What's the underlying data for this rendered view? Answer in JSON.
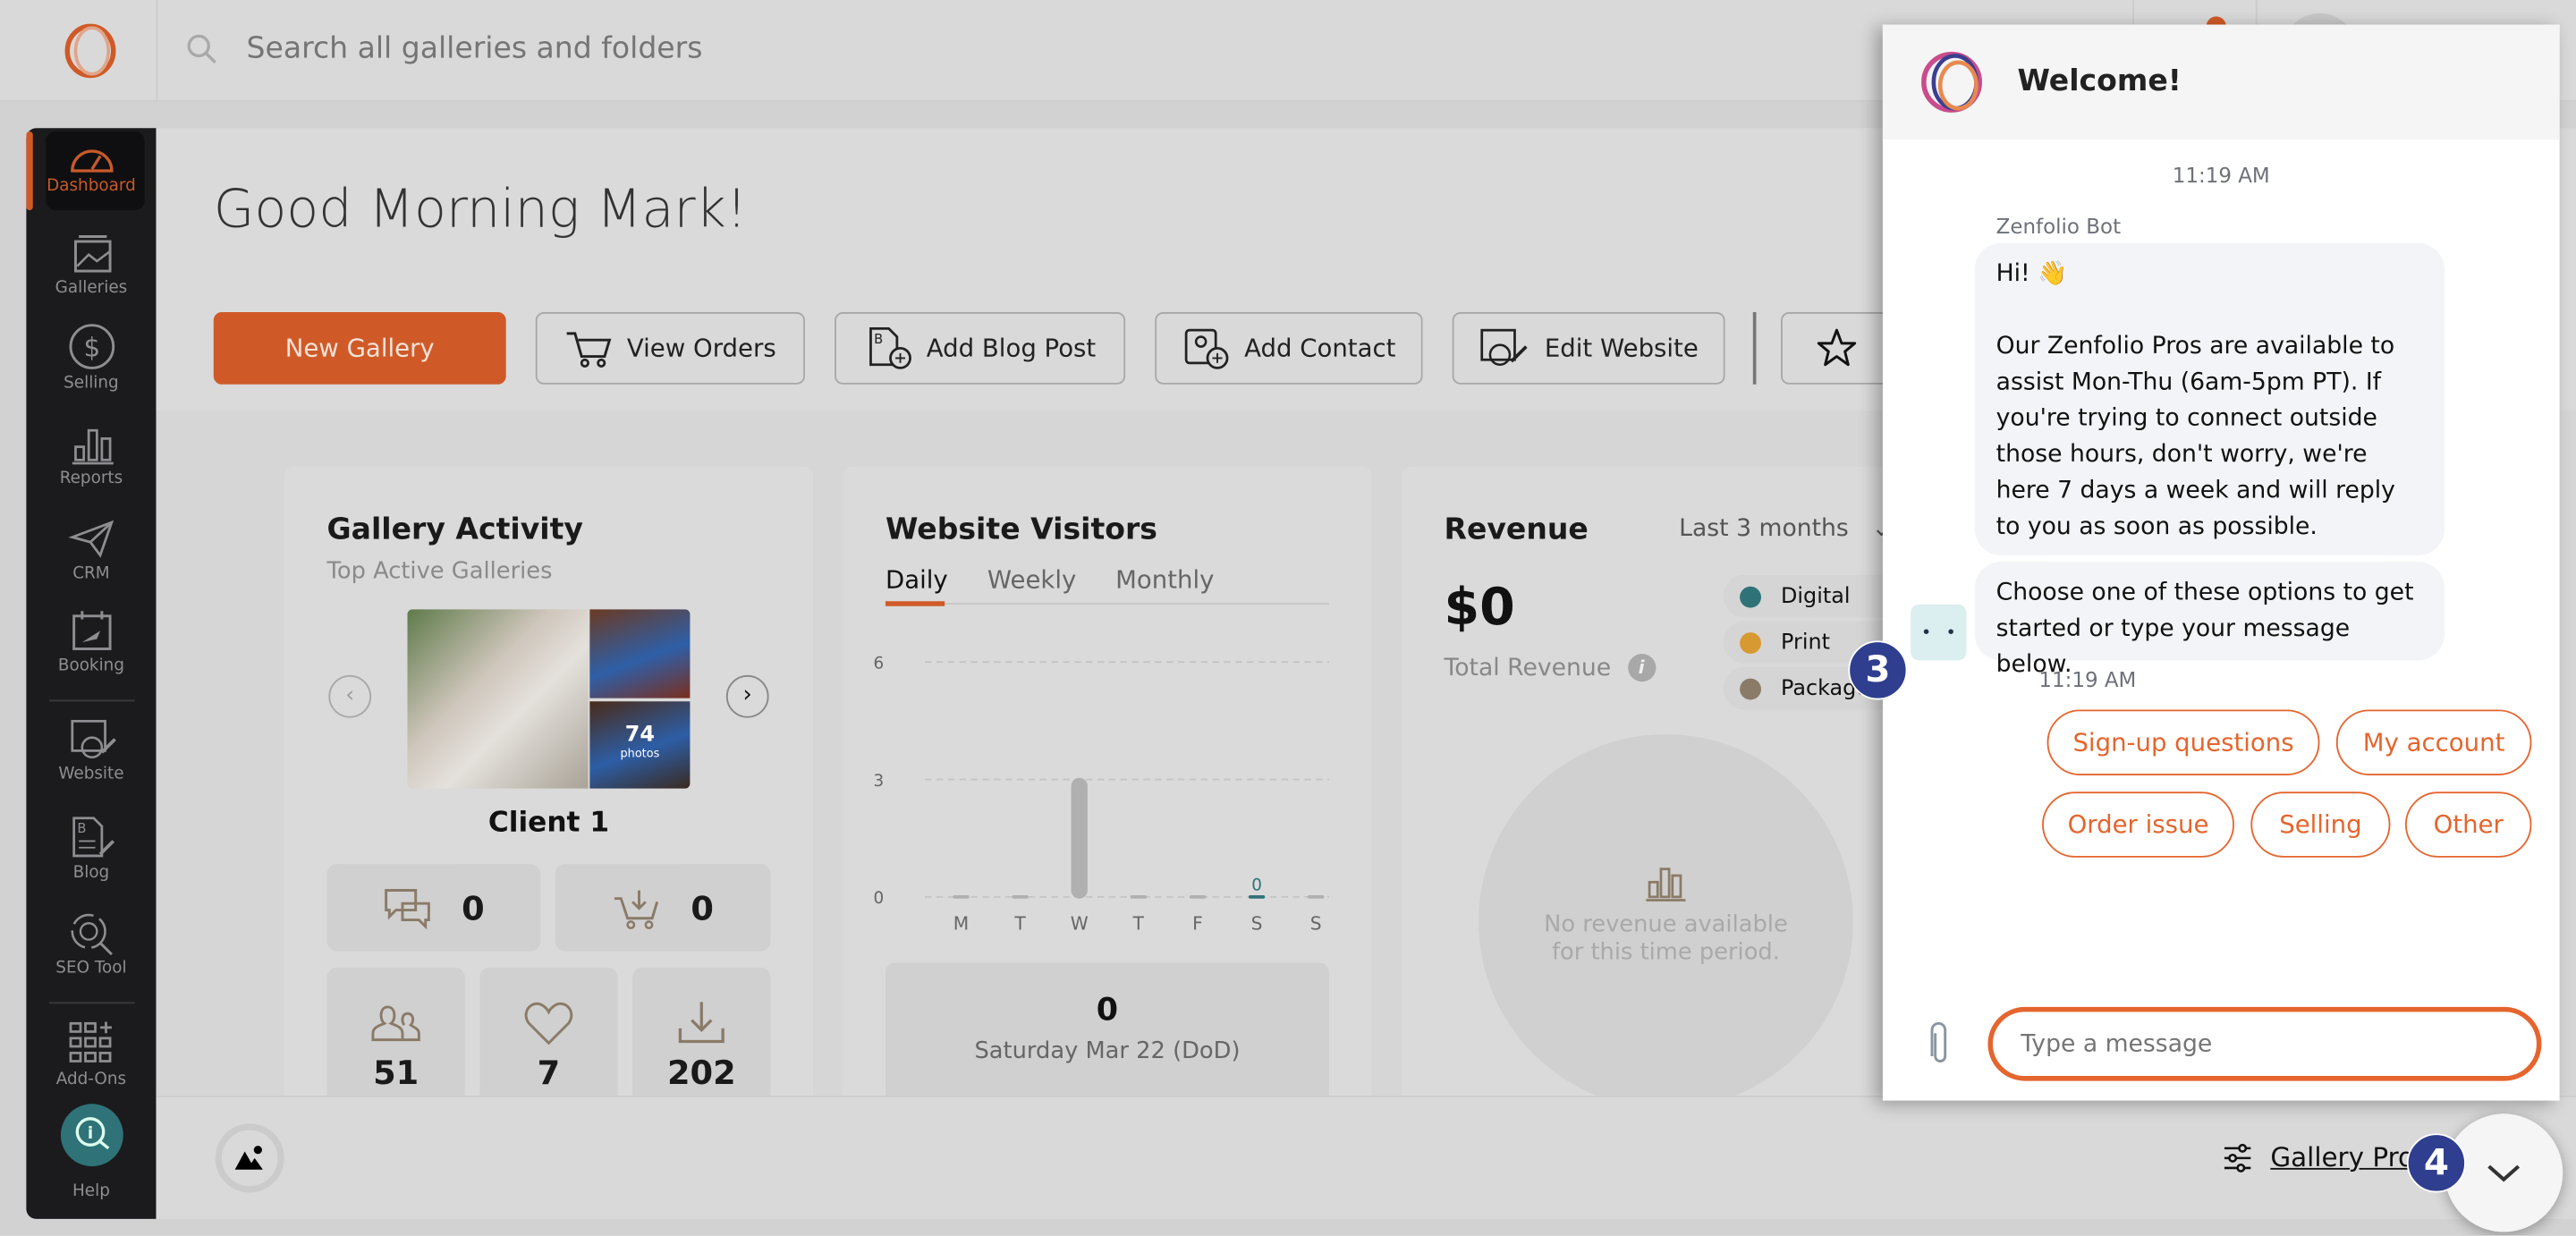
{
  "topbar": {
    "search_placeholder": "Search all galleries and folders"
  },
  "sidebar": {
    "items": [
      {
        "label": "Dashboard",
        "icon": "gauge-icon",
        "active": true
      },
      {
        "label": "Galleries",
        "icon": "gallery-icon"
      },
      {
        "label": "Selling",
        "icon": "dollar-icon"
      },
      {
        "label": "Reports",
        "icon": "bar-chart-icon"
      },
      {
        "label": "CRM",
        "icon": "paper-plane-icon"
      },
      {
        "label": "Booking",
        "icon": "calendar-icon"
      },
      {
        "label": "Website",
        "icon": "website-icon"
      },
      {
        "label": "Blog",
        "icon": "blog-icon"
      },
      {
        "label": "SEO Tool",
        "icon": "seo-icon"
      },
      {
        "label": "Add-Ons",
        "icon": "grid-plus-icon"
      },
      {
        "label": "Help",
        "icon": "help-search-icon"
      }
    ]
  },
  "main": {
    "greeting": "Good Morning Mark!",
    "actions": [
      "New Gallery",
      "View Orders",
      "Add Blog Post",
      "Add Contact",
      "Edit Website"
    ],
    "gallery_activity": {
      "title": "Gallery Activity",
      "subtitle": "Top Active Galleries",
      "photo_count": "74",
      "photo_unit": "photos",
      "client": "Client 1",
      "comments": "0",
      "orders": "0",
      "visitors": "51",
      "favorites": "7",
      "downloads": "202"
    },
    "website_visitors": {
      "title": "Website Visitors",
      "tabs": [
        "Daily",
        "Weekly",
        "Monthly"
      ],
      "active_tab": "Daily",
      "summary_value": "0",
      "summary_label": "Saturday Mar 22 (DoD)"
    },
    "revenue": {
      "title": "Revenue",
      "range": "Last 3 months",
      "total": "$0",
      "total_label": "Total Revenue",
      "legend": [
        {
          "label": "Digital",
          "color": "#2f7378"
        },
        {
          "label": "Print",
          "color": "#d79a32"
        },
        {
          "label": "Package",
          "color": "#8a7b68"
        }
      ],
      "empty_text_1": "No revenue available",
      "empty_text_2": "for this time period."
    }
  },
  "bottombar": {
    "link": "Gallery Pro"
  },
  "chat": {
    "title": "Welcome!",
    "time_top": "11:19 AM",
    "sender": "Zenfolio Bot",
    "message1_line1": "Hi! 👋",
    "message1_body": "Our Zenfolio Pros are available to assist Mon-Thu (6am-5pm PT). If you're trying to connect outside those hours, don't worry, we're here 7 days a week and will reply to you as soon as possible.",
    "message2": "Choose one of these options to get started or type your message below.",
    "time_bottom": "11:19 AM",
    "options": [
      "Sign-up questions",
      "My account",
      "Order issue",
      "Selling",
      "Other"
    ],
    "input_placeholder": "Type a message",
    "accent": "#e5652e"
  },
  "annotations": {
    "badge3": "3",
    "badge4": "4"
  },
  "chart_data": {
    "type": "bar",
    "categories": [
      "M",
      "T",
      "W",
      "T",
      "F",
      "S",
      "S"
    ],
    "values": [
      0,
      0,
      3,
      0,
      0,
      0,
      0
    ],
    "ylim": [
      0,
      6
    ],
    "yticks": [
      0,
      3,
      6
    ],
    "highlight_index": 5,
    "highlight_label": "0",
    "highlight_color": "#2f7378",
    "grid": true
  }
}
